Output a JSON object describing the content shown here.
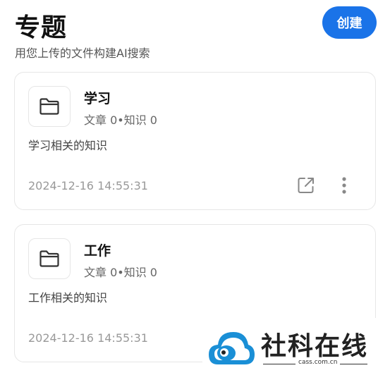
{
  "header": {
    "title": "专题",
    "subtitle": "用您上传的文件构建AI搜索",
    "create_label": "创建"
  },
  "colors": {
    "accent": "#1a73e8",
    "logo_blue": "#1a8fd6"
  },
  "cards": [
    {
      "title": "学习",
      "stats": "文章 0•知识 0",
      "description": "学习相关的知识",
      "timestamp": "2024-12-16 14:55:31",
      "icons": [
        "folder-icon",
        "share-icon",
        "more-vertical-icon"
      ]
    },
    {
      "title": "工作",
      "stats": "文章 0•知识 0",
      "description": "工作相关的知识",
      "timestamp": "2024-12-16 14:55:31",
      "icons": [
        "folder-icon"
      ]
    }
  ],
  "watermark": {
    "name": "社科在线",
    "url": "cass.com.cn"
  }
}
